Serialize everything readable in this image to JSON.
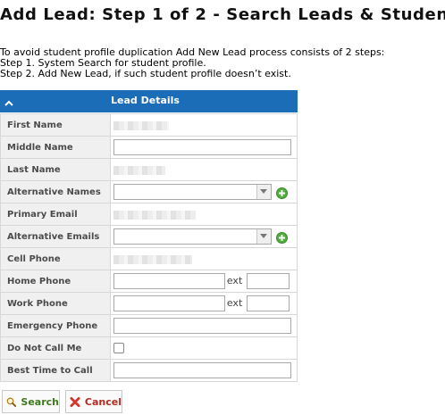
{
  "page": {
    "title": "Add Lead: Step 1 of 2 - Search Leads & Students",
    "intro": [
      "To avoid student profile duplication Add New Lead process consists of 2 steps:",
      "Step 1. System Search for student profile.",
      "Step 2. Add New Lead, if such student profile doesn’t exist."
    ]
  },
  "panel": {
    "title": "Lead Details",
    "collapse_icon": "chevron-up-icon",
    "header_color": "#1b6db8"
  },
  "fields": {
    "first_name": {
      "label": "First Name"
    },
    "middle_name": {
      "label": "Middle Name",
      "value": ""
    },
    "last_name": {
      "label": "Last Name"
    },
    "alternative_names": {
      "label": "Alternative Names",
      "selected": ""
    },
    "primary_email": {
      "label": "Primary Email"
    },
    "alternative_emails": {
      "label": "Alternative Emails",
      "selected": ""
    },
    "cell_phone": {
      "label": "Cell Phone"
    },
    "home_phone": {
      "label": "Home Phone",
      "value": "",
      "ext_label": "ext",
      "ext_value": ""
    },
    "work_phone": {
      "label": "Work Phone",
      "value": "",
      "ext_label": "ext",
      "ext_value": ""
    },
    "emergency_phone": {
      "label": "Emergency Phone",
      "value": ""
    },
    "do_not_call_me": {
      "label": "Do Not Call Me",
      "checked": false
    },
    "best_time_to_call": {
      "label": "Best Time to Call",
      "value": ""
    }
  },
  "buttons": {
    "search": {
      "label": "Search",
      "icon": "magnifier-icon",
      "color": "#3e7a1d"
    },
    "cancel": {
      "label": "Cancel",
      "icon": "red-x-icon",
      "color": "#b22a21"
    }
  }
}
